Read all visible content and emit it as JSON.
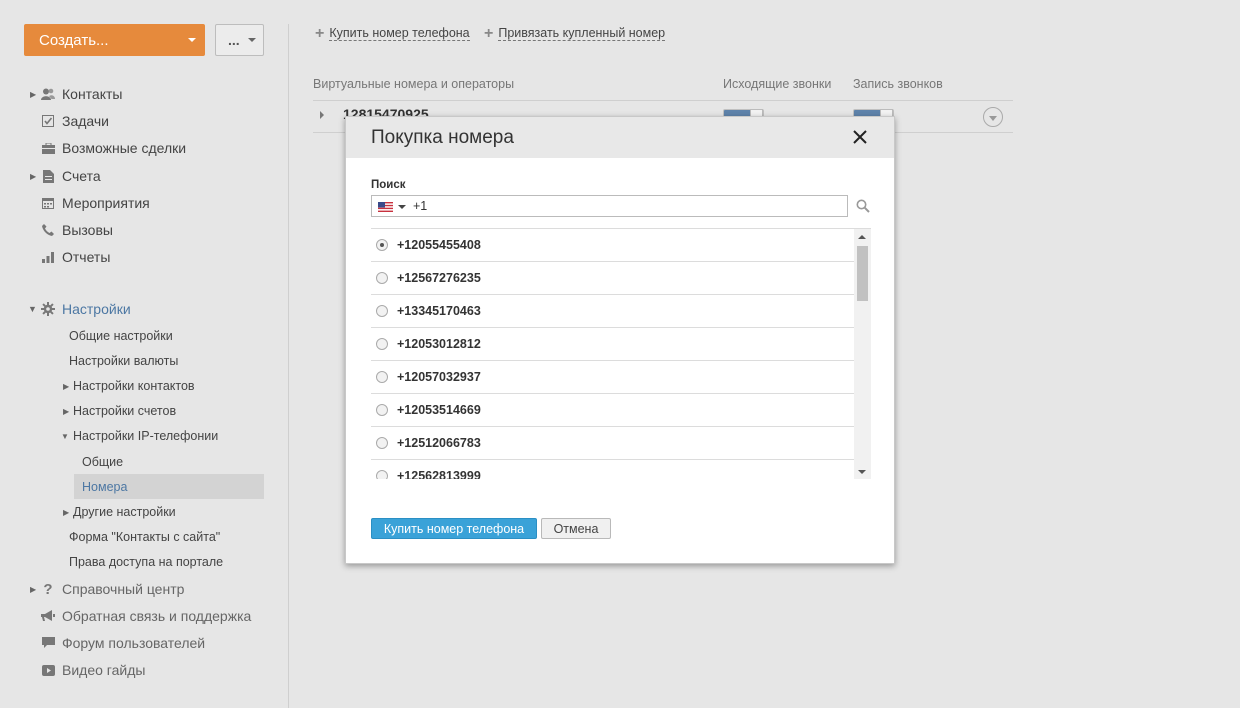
{
  "toolbar": {
    "create_label": "Создать...",
    "more_label": "..."
  },
  "sidebar": {
    "main_items": [
      {
        "label": "Контакты",
        "icon": "contacts-icon"
      },
      {
        "label": "Задачи",
        "icon": "tasks-icon"
      },
      {
        "label": "Возможные сделки",
        "icon": "deals-icon"
      },
      {
        "label": "Счета",
        "icon": "invoices-icon"
      },
      {
        "label": "Мероприятия",
        "icon": "calendar-icon"
      },
      {
        "label": "Вызовы",
        "icon": "phone-icon"
      },
      {
        "label": "Отчеты",
        "icon": "reports-icon"
      }
    ],
    "settings": {
      "label": "Настройки",
      "items": [
        "Общие настройки",
        "Настройки валюты",
        "Настройки контактов",
        "Настройки счетов",
        "Настройки IP-телефонии",
        "Общие",
        "Номера",
        "Другие настройки",
        "Форма \"Контакты с сайта\"",
        "Права доступа на портале"
      ]
    },
    "help_items": [
      {
        "label": "Справочный центр",
        "icon": "question-icon"
      },
      {
        "label": "Обратная связь и поддержка",
        "icon": "megaphone-icon"
      },
      {
        "label": "Форум пользователей",
        "icon": "chat-icon"
      },
      {
        "label": "Видео гайды",
        "icon": "video-icon"
      }
    ]
  },
  "main": {
    "links": [
      "Купить номер телефона",
      "Привязать купленный номер"
    ],
    "columns": [
      "Виртуальные номера и операторы",
      "Исходящие звонки",
      "Запись звонков"
    ],
    "row_number": "12815470925"
  },
  "modal": {
    "title": "Покупка номера",
    "search_label": "Поиск",
    "search_value": "+1",
    "numbers": [
      "+12055455408",
      "+12567276235",
      "+13345170463",
      "+12053012812",
      "+12057032937",
      "+12053514669",
      "+12512066783",
      "+12562813999"
    ],
    "selected_index": 0,
    "buy_label": "Купить номер телефона",
    "cancel_label": "Отмена"
  },
  "colors": {
    "accent_orange": "#e68a3c",
    "accent_blue": "#3aa2d8",
    "link_blue": "#4c77a3"
  }
}
